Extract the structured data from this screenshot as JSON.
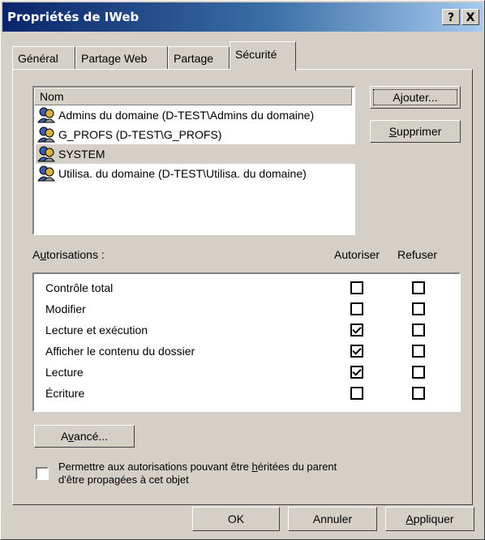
{
  "window": {
    "title": "Propriétés de IWeb",
    "help_label": "?",
    "close_label": "X"
  },
  "tabs": [
    {
      "label": "Général"
    },
    {
      "label": "Partage Web"
    },
    {
      "label": "Partage"
    },
    {
      "label": "Sécurité"
    }
  ],
  "users": {
    "header": "Nom",
    "items": [
      {
        "label": "Admins du domaine (D-TEST\\Admins du domaine)"
      },
      {
        "label": "G_PROFS (D-TEST\\G_PROFS)"
      },
      {
        "label": "SYSTEM"
      },
      {
        "label": "Utilisa. du domaine (D-TEST\\Utilisa. du domaine)"
      }
    ],
    "add_button": {
      "pre": "A",
      "accel": "j",
      "post": "outer..."
    },
    "remove_button": {
      "pre": "",
      "accel": "S",
      "post": "upprimer"
    }
  },
  "permissions": {
    "label": {
      "pre": "A",
      "accel": "u",
      "post": "torisations :"
    },
    "col_allow": "Autoriser",
    "col_deny": "Refuser",
    "items": [
      {
        "label": "Contrôle total",
        "allow": false,
        "deny": false
      },
      {
        "label": "Modifier",
        "allow": false,
        "deny": false
      },
      {
        "label": "Lecture et exécution",
        "allow": true,
        "deny": false
      },
      {
        "label": "Afficher le contenu du dossier",
        "allow": true,
        "deny": false
      },
      {
        "label": "Lecture",
        "allow": true,
        "deny": false
      },
      {
        "label": "Écriture",
        "allow": false,
        "deny": false
      }
    ]
  },
  "advanced_button": {
    "pre": "A",
    "accel": "v",
    "post": "ancé..."
  },
  "inherit": {
    "line1_pre": "Permettre aux autorisations pouvant être ",
    "line1_accel": "h",
    "line1_post": "éritées du parent",
    "line2": "d'être propagées à cet objet",
    "checked": false
  },
  "footer": {
    "ok": "OK",
    "cancel": "Annuler",
    "apply": {
      "pre": "",
      "accel": "A",
      "post": "ppliquer"
    }
  }
}
